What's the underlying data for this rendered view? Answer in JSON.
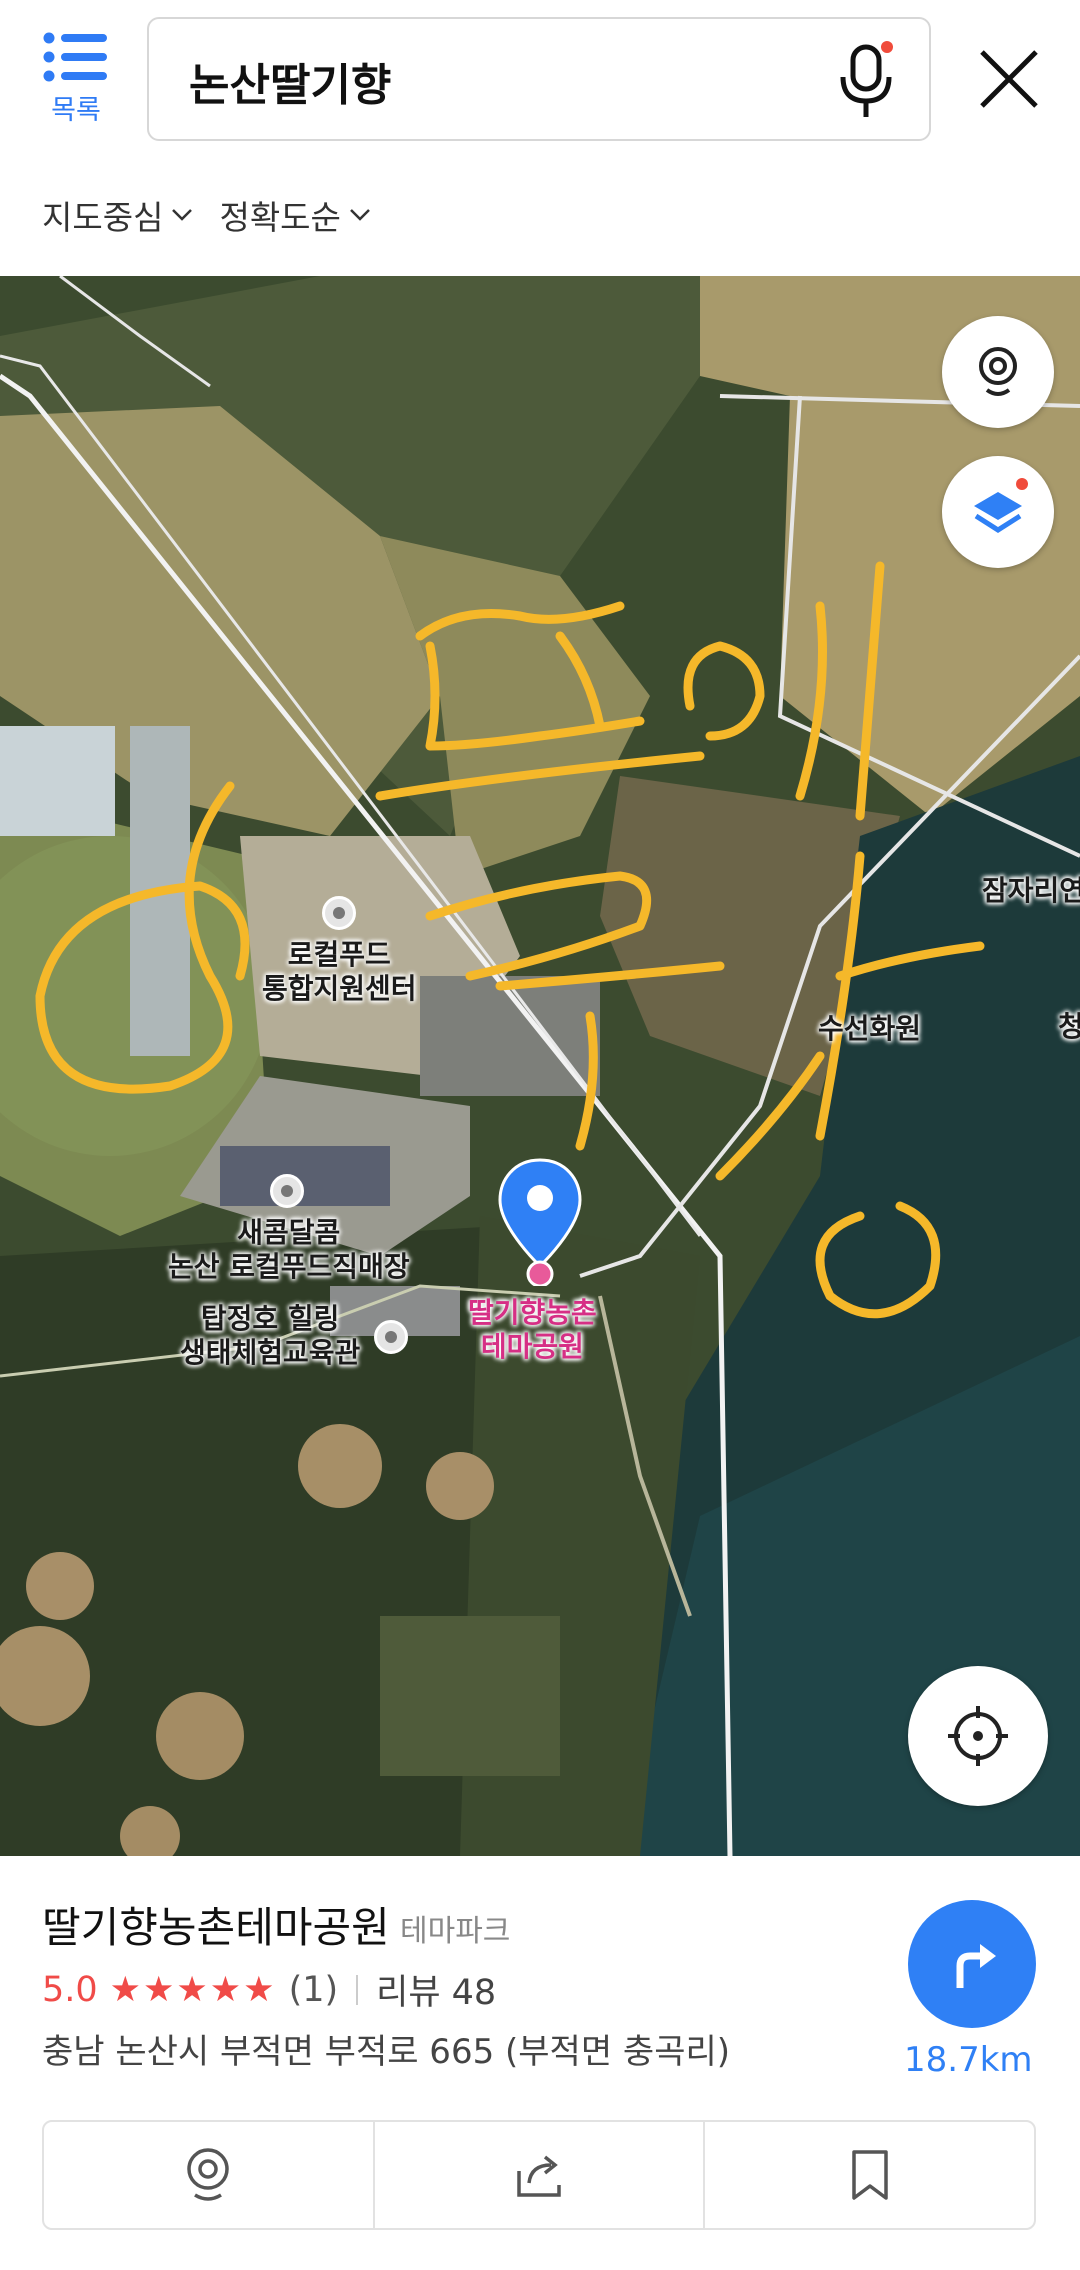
{
  "header": {
    "list_label": "목록",
    "search_value": "논산딸기향",
    "filters": [
      "지도중심",
      "정확도순"
    ]
  },
  "map": {
    "labels": {
      "local_food_center": "로컬푸드\n통합지원센터",
      "saekom": "새콤달콤\n논산 로컬푸드직매장",
      "tapjeongho": "탑정호 힐링\n생태체험교육관",
      "selected_place": "딸기향농촌\n테마공원",
      "susun": "수선화원",
      "jamjari": "잠자리연",
      "cheong": "청"
    },
    "handwriting": "모노이 소질이 장"
  },
  "place": {
    "name": "딸기향농촌테마공원",
    "category": "테마파크",
    "rating": "5.0",
    "stars": "★★★★★",
    "rating_count": "(1)",
    "review": "리뷰 48",
    "address": "충남 논산시 부적면 부적로 665 (부적면 충곡리)",
    "distance": "18.7km"
  },
  "colors": {
    "accent": "#2f80f5",
    "rating": "#f04b48",
    "handwriting": "#f5b82a"
  },
  "icons": [
    "list-icon",
    "mic-icon",
    "close-icon",
    "chevron-down-icon",
    "street-view-icon",
    "layers-icon",
    "current-location-icon",
    "directions-icon",
    "pin-icon",
    "share-icon",
    "bookmark-icon"
  ]
}
